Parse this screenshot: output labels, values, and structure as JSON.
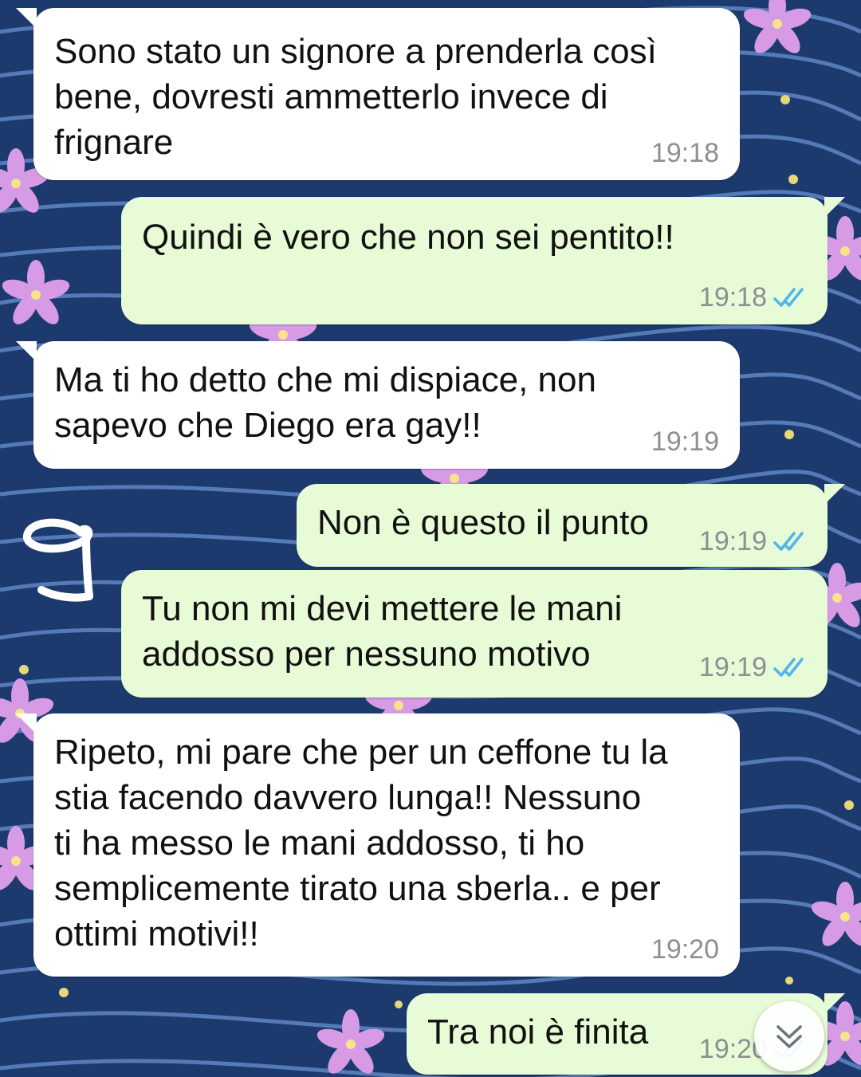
{
  "chat": {
    "messages": [
      {
        "direction": "incoming",
        "lines": [
          "Sono stato un signore a prenderla così",
          "bene, dovresti ammetterlo invece di",
          "frignare"
        ],
        "time": "19:18"
      },
      {
        "direction": "outgoing",
        "lines": [
          "Quindi è vero che non sei pentito!!"
        ],
        "time": "19:18",
        "status": "read"
      },
      {
        "direction": "incoming",
        "lines": [
          "Ma ti ho detto che mi dispiace, non",
          "sapevo che Diego era gay!!"
        ],
        "time": "19:19"
      },
      {
        "direction": "outgoing",
        "lines": [
          "Non è questo il punto"
        ],
        "time": "19:19",
        "status": "read"
      },
      {
        "direction": "outgoing",
        "lines": [
          "Tu non mi devi mettere le mani",
          "addosso per nessuno motivo"
        ],
        "time": "19:19",
        "status": "read"
      },
      {
        "direction": "incoming",
        "lines": [
          "Ripeto, mi pare che per un ceffone tu la",
          "stia facendo davvero lunga!! Nessuno",
          "ti ha messo le mani addosso, ti ho",
          "semplicemente tirato una sberla.. e per",
          "ottimi motivi!!"
        ],
        "time": "19:20"
      },
      {
        "direction": "outgoing",
        "lines": [
          "Tra noi è finita"
        ],
        "time": "19:20",
        "status": "read"
      }
    ],
    "m0": {
      "text": "Sono stato un signore a prenderla così\nbene, dovresti ammetterlo invece di\nfrignare",
      "time": "19:18"
    },
    "m1": {
      "text": "Quindi è vero che non sei pentito!!",
      "time": "19:18"
    },
    "m2": {
      "text": "Ma ti ho detto che mi dispiace, non\nsapevo che Diego era gay!!",
      "time": "19:19"
    },
    "m3": {
      "text": "Non è questo il punto",
      "time": "19:19"
    },
    "m4": {
      "text": "Tu non mi devi mettere le mani\naddosso per nessuno motivo",
      "time": "19:19"
    },
    "m5": {
      "text": "Ripeto, mi pare che per un ceffone tu la\nstia facendo davvero lunga!! Nessuno\nti ha messo le mani addosso, ti ho\nsemplicemente tirato una sberla.. e per\nottimi motivi!!",
      "time": "19:20"
    },
    "m6": {
      "text": "Tra noi è finita",
      "time": "19:20"
    }
  },
  "annotation": {
    "mark": "9"
  },
  "icons": {
    "read_receipt": "double-check-icon",
    "scroll_down": "double-chevron-down-icon"
  },
  "colors": {
    "wallpaper": "#1d3a6e",
    "incoming_bubble": "#ffffff",
    "outgoing_bubble": "#e7fbd6",
    "read_ticks": "#4fb6ec",
    "timestamp": "#8c8f93"
  }
}
